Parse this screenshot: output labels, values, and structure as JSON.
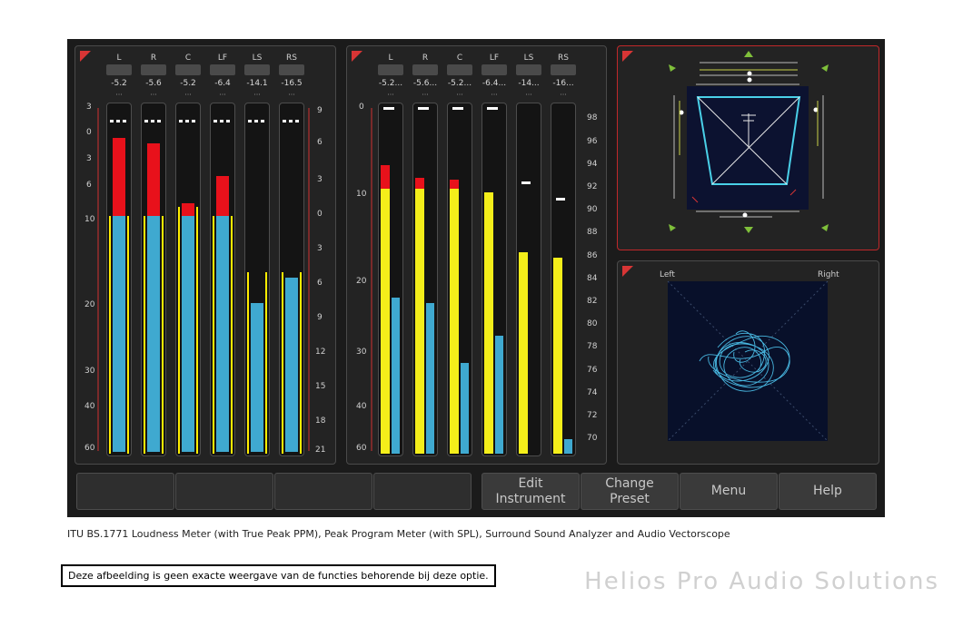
{
  "loudness_meter": {
    "channels": [
      "L",
      "R",
      "C",
      "LF",
      "LS",
      "RS"
    ],
    "peaks": [
      "-5.2",
      "-5.6",
      "-5.2",
      "-6.4",
      "-14.1",
      "-16.5"
    ],
    "left_scale": [
      "3",
      "0",
      "3",
      "6",
      "10",
      "20",
      "30",
      "40",
      "60"
    ],
    "right_scale": [
      "9",
      "6",
      "3",
      "0",
      "3",
      "6",
      "9",
      "12",
      "15",
      "18",
      "21"
    ]
  },
  "ppm_meter": {
    "channels": [
      "L",
      "R",
      "C",
      "LF",
      "LS",
      "RS"
    ],
    "peaks": [
      "-5.2...",
      "-5.6...",
      "-5.2...",
      "-6.4...",
      "-14...",
      "-16..."
    ],
    "left_scale": [
      "0",
      "10",
      "20",
      "30",
      "40",
      "60"
    ],
    "right_scale": [
      "98",
      "96",
      "94",
      "92",
      "90",
      "88",
      "86",
      "84",
      "82",
      "80",
      "78",
      "76",
      "74",
      "72",
      "70"
    ]
  },
  "vectorscope": {
    "left_label": "Left",
    "right_label": "Right"
  },
  "buttons": {
    "edit": "Edit\nInstrument",
    "change": "Change\nPreset",
    "menu": "Menu",
    "help": "Help"
  },
  "caption": "ITU BS.1771 Loudness Meter (with True Peak PPM), Peak Program Meter (with SPL), Surround Sound Analyzer and Audio Vectorscope",
  "disclaimer": "Deze afbeelding is geen exacte weergave van de functies behorende bij deze optie.",
  "brand": "Helios Pro Audio Solutions",
  "colors": {
    "bar_blue": "#3fa9d0",
    "bar_yellow": "#f4ee1a",
    "bar_red": "#e8111b",
    "active_border": "#c0282a"
  }
}
